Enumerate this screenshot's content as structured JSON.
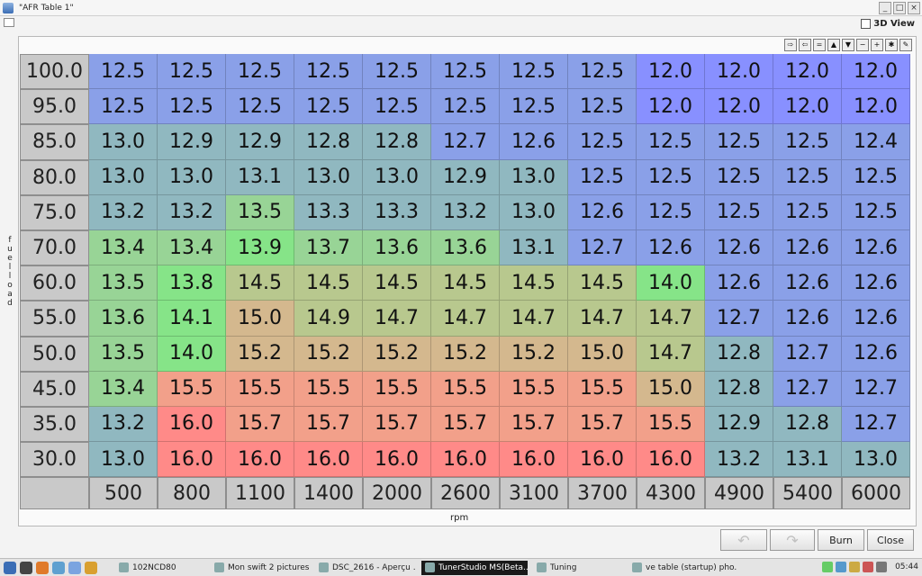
{
  "window": {
    "title": "\"AFR Table 1\""
  },
  "controls": {
    "view3d_label": "3D View",
    "view3d_checked": false
  },
  "mini_toolbar": [
    {
      "icon": "arrow-right-icon",
      "glyph": "⇨"
    },
    {
      "icon": "arrow-left-icon",
      "glyph": "⇦"
    },
    {
      "icon": "equals-icon",
      "glyph": "="
    },
    {
      "icon": "triangle-up-icon",
      "glyph": "▲"
    },
    {
      "icon": "triangle-down-icon",
      "glyph": "▼"
    },
    {
      "icon": "minus-icon",
      "glyph": "−"
    },
    {
      "icon": "plus-icon",
      "glyph": "+"
    },
    {
      "icon": "asterisk-icon",
      "glyph": "✱"
    },
    {
      "icon": "pencil-icon",
      "glyph": "✎"
    }
  ],
  "table": {
    "y_axis_label": "fuelload",
    "x_axis_label": "rpm",
    "row_labels": [
      "100.0",
      "95.0",
      "85.0",
      "80.0",
      "75.0",
      "70.0",
      "60.0",
      "55.0",
      "50.0",
      "45.0",
      "35.0",
      "30.0"
    ],
    "col_labels": [
      "500",
      "800",
      "1100",
      "1400",
      "2000",
      "2600",
      "3100",
      "3700",
      "4300",
      "4900",
      "5400",
      "6000"
    ],
    "values": [
      [
        "12.5",
        "12.5",
        "12.5",
        "12.5",
        "12.5",
        "12.5",
        "12.5",
        "12.5",
        "12.0",
        "12.0",
        "12.0",
        "12.0"
      ],
      [
        "12.5",
        "12.5",
        "12.5",
        "12.5",
        "12.5",
        "12.5",
        "12.5",
        "12.5",
        "12.0",
        "12.0",
        "12.0",
        "12.0"
      ],
      [
        "13.0",
        "12.9",
        "12.9",
        "12.8",
        "12.8",
        "12.7",
        "12.6",
        "12.5",
        "12.5",
        "12.5",
        "12.5",
        "12.4"
      ],
      [
        "13.0",
        "13.0",
        "13.1",
        "13.0",
        "13.0",
        "12.9",
        "13.0",
        "12.5",
        "12.5",
        "12.5",
        "12.5",
        "12.5"
      ],
      [
        "13.2",
        "13.2",
        "13.5",
        "13.3",
        "13.3",
        "13.2",
        "13.0",
        "12.6",
        "12.5",
        "12.5",
        "12.5",
        "12.5"
      ],
      [
        "13.4",
        "13.4",
        "13.9",
        "13.7",
        "13.6",
        "13.6",
        "13.1",
        "12.7",
        "12.6",
        "12.6",
        "12.6",
        "12.6"
      ],
      [
        "13.5",
        "13.8",
        "14.5",
        "14.5",
        "14.5",
        "14.5",
        "14.5",
        "14.5",
        "14.0",
        "12.6",
        "12.6",
        "12.6"
      ],
      [
        "13.6",
        "14.1",
        "15.0",
        "14.9",
        "14.7",
        "14.7",
        "14.7",
        "14.7",
        "14.7",
        "12.7",
        "12.6",
        "12.6"
      ],
      [
        "13.5",
        "14.0",
        "15.2",
        "15.2",
        "15.2",
        "15.2",
        "15.2",
        "15.0",
        "14.7",
        "12.8",
        "12.7",
        "12.6"
      ],
      [
        "13.4",
        "15.5",
        "15.5",
        "15.5",
        "15.5",
        "15.5",
        "15.5",
        "15.5",
        "15.0",
        "12.8",
        "12.7",
        "12.7"
      ],
      [
        "13.2",
        "16.0",
        "15.7",
        "15.7",
        "15.7",
        "15.7",
        "15.7",
        "15.7",
        "15.5",
        "12.9",
        "12.8",
        "12.7"
      ],
      [
        "13.0",
        "16.0",
        "16.0",
        "16.0",
        "16.0",
        "16.0",
        "16.0",
        "16.0",
        "16.0",
        "13.2",
        "13.1",
        "13.0"
      ]
    ]
  },
  "buttons": {
    "burn": "Burn",
    "close": "Close"
  },
  "taskbar": {
    "tasks": [
      "102NCD80",
      "Mon swift 2 pictures ...",
      "DSC_2616 - Aperçu ...",
      "TunerStudio MS(Beta...",
      "Tuning",
      "ve table (startup) pho..."
    ],
    "active_index": 3,
    "clock": "05:44"
  },
  "colors": {
    "cell_blue": "#8aa0e8",
    "cell_violet": "#8890ff",
    "cell_teal": "#90b8c0",
    "cell_green": "#86e488",
    "cell_tan": "#d4b88e",
    "cell_red": "#ff8a88",
    "header_gray": "#c9c9c9"
  }
}
